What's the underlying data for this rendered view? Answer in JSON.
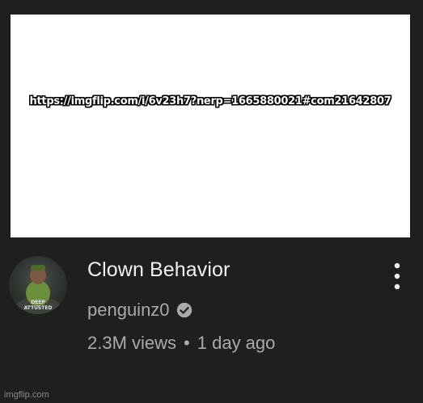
{
  "thumbnail": {
    "caption": "https://imgflip.com/i/6v23h7?nerp=1665880021#com21642807"
  },
  "video": {
    "title": "Clown Behavior",
    "channel": "penguinz0",
    "views": "2.3M views",
    "separator": "•",
    "age": "1 day ago"
  },
  "avatar": {
    "text_line1": "DEEP",
    "text_line2": "ATTUSTED"
  },
  "icons": {
    "verified": "check-circle-icon",
    "menu": "vertical-ellipsis-icon"
  },
  "colors": {
    "background": "#1f1f20",
    "title": "#f1f1f1",
    "secondary_text": "#aaaaaa",
    "verified_badge": "#aaaaaa"
  },
  "watermark": "imgflip.com"
}
